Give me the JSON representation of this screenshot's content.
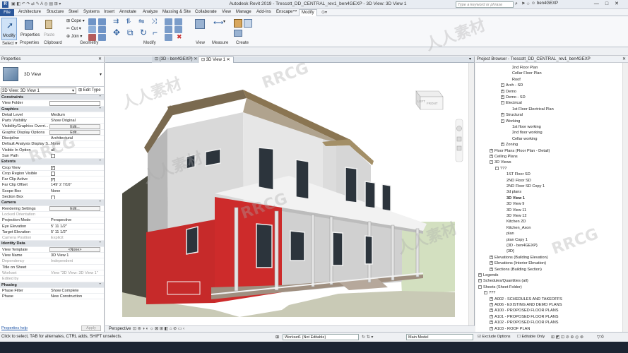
{
  "app": {
    "title": "Autodesk Revit 2019 - Trescott_DD_CENTRAL_rev1_ben4GEXP - 3D View: 3D View 1",
    "search_placeholder": "Type a keyword or phrase",
    "user": "ben4GEXP"
  },
  "ribbon_tabs": [
    "File",
    "Architecture",
    "Structure",
    "Steel",
    "Systems",
    "Insert",
    "Annotate",
    "Analyze",
    "Massing & Site",
    "Collaborate",
    "View",
    "Manage",
    "Add-Ins",
    "Enscape™",
    "Modify"
  ],
  "ribbon": {
    "modify_label": "Modify",
    "properties_label": "Properties",
    "paste_label": "Paste",
    "cope_label": "Cope",
    "cut_label": "Cut",
    "join_label": "Join",
    "panels": [
      "Select ▾",
      "Properties",
      "Clipboard",
      "Geometry",
      "Modify",
      "View",
      "Measure",
      "Create"
    ]
  },
  "properties": {
    "header": "Properties",
    "type_name": "3D View",
    "instance": "3D View: 3D View 1",
    "edit_type": "Edit Type",
    "rows": [
      {
        "kind": "grp",
        "k": "Constraints"
      },
      {
        "k": "View Folder",
        "v": "",
        "input": true
      },
      {
        "kind": "grp",
        "k": "Graphics"
      },
      {
        "k": "Detail Level",
        "v": "Medium"
      },
      {
        "k": "Parts Visibility",
        "v": "Show Original"
      },
      {
        "k": "Visibility/Graphics Overri...",
        "btn": "Edit..."
      },
      {
        "k": "Graphic Display Options",
        "btn": "Edit..."
      },
      {
        "k": "Discipline",
        "v": "Architectural"
      },
      {
        "k": "Default Analysis Display S...",
        "v": "None"
      },
      {
        "k": "Visible In Option",
        "v": "all"
      },
      {
        "k": "Sun Path",
        "chk": false
      },
      {
        "kind": "grp",
        "k": "Extents"
      },
      {
        "k": "Crop View",
        "chk": true
      },
      {
        "k": "Crop Region Visible",
        "chk": false
      },
      {
        "k": "Far Clip Active",
        "chk": true
      },
      {
        "k": "Far Clip Offset",
        "v": "149'  2 7/16\""
      },
      {
        "k": "Scope Box",
        "v": "None"
      },
      {
        "k": "Section Box",
        "chk": false
      },
      {
        "kind": "grp",
        "k": "Camera"
      },
      {
        "k": "Rendering Settings",
        "btn": "Edit..."
      },
      {
        "k": "Locked Orientation",
        "v": "",
        "dim": true
      },
      {
        "k": "Projection Mode",
        "v": "Perspective"
      },
      {
        "k": "Eye Elevation",
        "v": "5'  11 1/2\""
      },
      {
        "k": "Target Elevation",
        "v": "5'  11 1/2\""
      },
      {
        "k": "Camera Position",
        "v": "Explicit",
        "dim": true
      },
      {
        "kind": "grp",
        "k": "Identity Data"
      },
      {
        "k": "View Template",
        "btn": "<None>"
      },
      {
        "k": "View Name",
        "v": "3D View 1"
      },
      {
        "k": "Dependency",
        "v": "Independent",
        "dim": true
      },
      {
        "k": "Title on Sheet",
        "v": ""
      },
      {
        "k": "Workset",
        "v": "View \"3D View: 3D View 1\"",
        "dim": true
      },
      {
        "k": "Edited by",
        "v": "",
        "dim": true
      },
      {
        "kind": "grp",
        "k": "Phasing"
      },
      {
        "k": "Phase Filter",
        "v": "Show Complete"
      },
      {
        "k": "Phase",
        "v": "New Construction"
      }
    ],
    "help_link": "Properties help",
    "apply": "Apply"
  },
  "view_tabs": {
    "inactive": "{3D - ben4GEXP}",
    "active": "3D View 1"
  },
  "viewcube": {
    "left": "LEFT",
    "front": "FRONT"
  },
  "view_control": {
    "mode": "Perspective"
  },
  "project_browser": {
    "header": "Project Browser - Trescott_DD_CENTRAL_rev1_ben4GEXP",
    "items": [
      {
        "t": "2nd Floor Plan",
        "lvl": 6
      },
      {
        "t": "Cellar Floor Plan",
        "lvl": 6
      },
      {
        "t": "Roof",
        "lvl": 6
      },
      {
        "t": "Arch - SD",
        "lvl": 4,
        "tog": "-"
      },
      {
        "t": "Demo",
        "lvl": 4,
        "tog": "+"
      },
      {
        "t": "Demo - SD",
        "lvl": 4,
        "tog": "+"
      },
      {
        "t": "Electrical",
        "lvl": 4,
        "tog": "-"
      },
      {
        "t": "1st Floor Electrical Plan",
        "lvl": 6
      },
      {
        "t": "Structural",
        "lvl": 4,
        "tog": "+"
      },
      {
        "t": "Working",
        "lvl": 4,
        "tog": "-"
      },
      {
        "t": "1st floor working",
        "lvl": 6
      },
      {
        "t": "2nd floor working",
        "lvl": 6
      },
      {
        "t": "Cellar working",
        "lvl": 6
      },
      {
        "t": "Zoning",
        "lvl": 4,
        "tog": "+"
      },
      {
        "t": "Floor Plans (Floor Plan - Detail)",
        "lvl": 2,
        "tog": "+"
      },
      {
        "t": "Ceiling Plans",
        "lvl": 2,
        "tog": "+"
      },
      {
        "t": "3D Views",
        "lvl": 2,
        "tog": "-"
      },
      {
        "t": "???",
        "lvl": 3,
        "tog": "-"
      },
      {
        "t": "1ST Floor SD",
        "lvl": 5
      },
      {
        "t": "2ND Floor SD",
        "lvl": 5
      },
      {
        "t": "2ND Floor SD Copy 1",
        "lvl": 5
      },
      {
        "t": "3d plans",
        "lvl": 5
      },
      {
        "t": "3D View 1",
        "lvl": 5,
        "bold": true
      },
      {
        "t": "3D View 9",
        "lvl": 5
      },
      {
        "t": "3D View 11",
        "lvl": 5
      },
      {
        "t": "3D View 12",
        "lvl": 5
      },
      {
        "t": "Kitchen 2D",
        "lvl": 5
      },
      {
        "t": "Kitchen_Axon",
        "lvl": 5
      },
      {
        "t": "plan",
        "lvl": 5
      },
      {
        "t": "plan Copy 1",
        "lvl": 5
      },
      {
        "t": "{3D - ben4GEXP}",
        "lvl": 5
      },
      {
        "t": "{3D}",
        "lvl": 5
      },
      {
        "t": "Elevations (Building Elevation)",
        "lvl": 2,
        "tog": "+"
      },
      {
        "t": "Elevations (Interior Elevation)",
        "lvl": 2,
        "tog": "+"
      },
      {
        "t": "Sections (Building Section)",
        "lvl": 2,
        "tog": "+"
      },
      {
        "t": "Legends",
        "lvl": 0,
        "tog": "+"
      },
      {
        "t": "Schedules/Quantities (all)",
        "lvl": 0,
        "tog": "+"
      },
      {
        "t": "Sheets (Sheet Folder)",
        "lvl": 0,
        "tog": "-"
      },
      {
        "t": "???",
        "lvl": 1,
        "tog": "-"
      },
      {
        "t": "A002 - SCHEDULES AND TAKEOFFS",
        "lvl": 2,
        "tog": "+"
      },
      {
        "t": "A006 - EXISTING AND DEMO PLANS",
        "lvl": 2,
        "tog": "+"
      },
      {
        "t": "A100 - PROPOSED FLOOR PLANS",
        "lvl": 2,
        "tog": "+"
      },
      {
        "t": "A101 - PROPOSED FLOOR PLANS",
        "lvl": 2,
        "tog": "+"
      },
      {
        "t": "A102 - PROPOSED FLOOR PLANS",
        "lvl": 2,
        "tog": "+"
      },
      {
        "t": "A103 - ROOF PLAN",
        "lvl": 2,
        "tog": "+"
      },
      {
        "t": "A200 - EXTERIOR ELEVATIONS",
        "lvl": 2,
        "tog": "+"
      }
    ]
  },
  "status": {
    "message": "Click to select, TAB for alternates, CTRL adds, SHIFT unselects.",
    "workset": "Workset1 (Not Editable)",
    "model": "Main Model",
    "exclude": "Exclude Options",
    "editable": "Editable Only",
    "filter": ":0"
  },
  "watermarks": [
    "RRCG",
    "人人素材"
  ]
}
